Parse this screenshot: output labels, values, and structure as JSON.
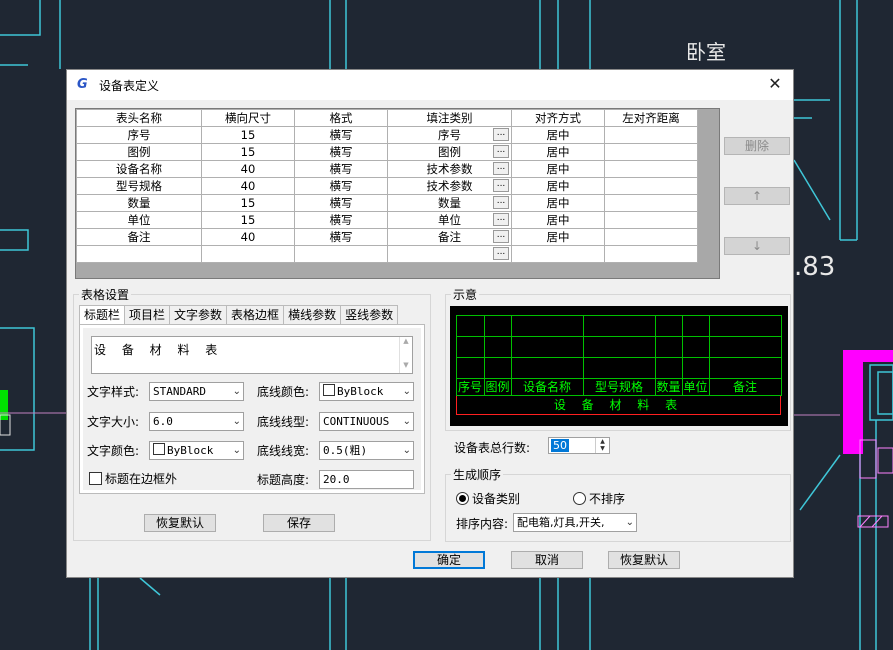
{
  "background": {
    "room_label": "卧室",
    "dimension_text": ".83",
    "colors": {
      "cad_bg": "#1f2733",
      "cyan": "#3fc6d8",
      "magenta": "#ff00ff",
      "green": "#00ff00"
    }
  },
  "dialog": {
    "title": "设备表定义",
    "title_icon": "G",
    "close_label": "✕"
  },
  "grid": {
    "columns": [
      "表头名称",
      "横向尺寸",
      "格式",
      "填注类别",
      "对齐方式",
      "左对齐距离"
    ],
    "rows": [
      [
        "序号",
        "15",
        "横写",
        "序号",
        "居中",
        ""
      ],
      [
        "图例",
        "15",
        "横写",
        "图例",
        "居中",
        ""
      ],
      [
        "设备名称",
        "40",
        "横写",
        "技术参数",
        "居中",
        ""
      ],
      [
        "型号规格",
        "40",
        "横写",
        "技术参数",
        "居中",
        ""
      ],
      [
        "数量",
        "15",
        "横写",
        "数量",
        "居中",
        ""
      ],
      [
        "单位",
        "15",
        "横写",
        "单位",
        "居中",
        ""
      ],
      [
        "备注",
        "40",
        "横写",
        "备注",
        "居中",
        ""
      ],
      [
        "",
        "",
        "",
        "",
        "",
        ""
      ]
    ],
    "ellipsis": "..."
  },
  "side_buttons": {
    "delete": "删除",
    "up": "↑",
    "down": "↓"
  },
  "table_settings": {
    "group_label": "表格设置",
    "tabs": [
      "标题栏",
      "项目栏",
      "文字参数",
      "表格边框",
      "横线参数",
      "竖线参数"
    ],
    "title_text": "设 备 材 料 表",
    "text_style_label": "文字样式:",
    "text_style_value": "STANDARD",
    "text_size_label": "文字大小:",
    "text_size_value": "6.0",
    "text_color_label": "文字颜色:",
    "text_color_value": "ByBlock",
    "bottom_color_label": "底线颜色:",
    "bottom_color_value": "ByBlock",
    "bottom_linetype_label": "底线线型:",
    "bottom_linetype_value": "CONTINUOUS",
    "bottom_linewidth_label": "底线线宽:",
    "bottom_linewidth_value": "0.5(粗)",
    "title_outside_label": "标题在边框外",
    "title_height_label": "标题高度:",
    "title_height_value": "20.0",
    "restore_default": "恢复默认",
    "save": "保存"
  },
  "preview": {
    "group_label": "示意",
    "headers": [
      "序号",
      "图例",
      "设备名称",
      "型号规格",
      "数量",
      "单位",
      "备注"
    ],
    "title": "设 备 材 料 表"
  },
  "total_rows": {
    "label": "设备表总行数:",
    "value": "50"
  },
  "order": {
    "group_label": "生成顺序",
    "by_category": "设备类别",
    "no_sort": "不排序",
    "sort_content_label": "排序内容:",
    "sort_content_value": "配电箱,灯具,开关,"
  },
  "footer": {
    "ok": "确定",
    "cancel": "取消",
    "restore_default": "恢复默认"
  }
}
